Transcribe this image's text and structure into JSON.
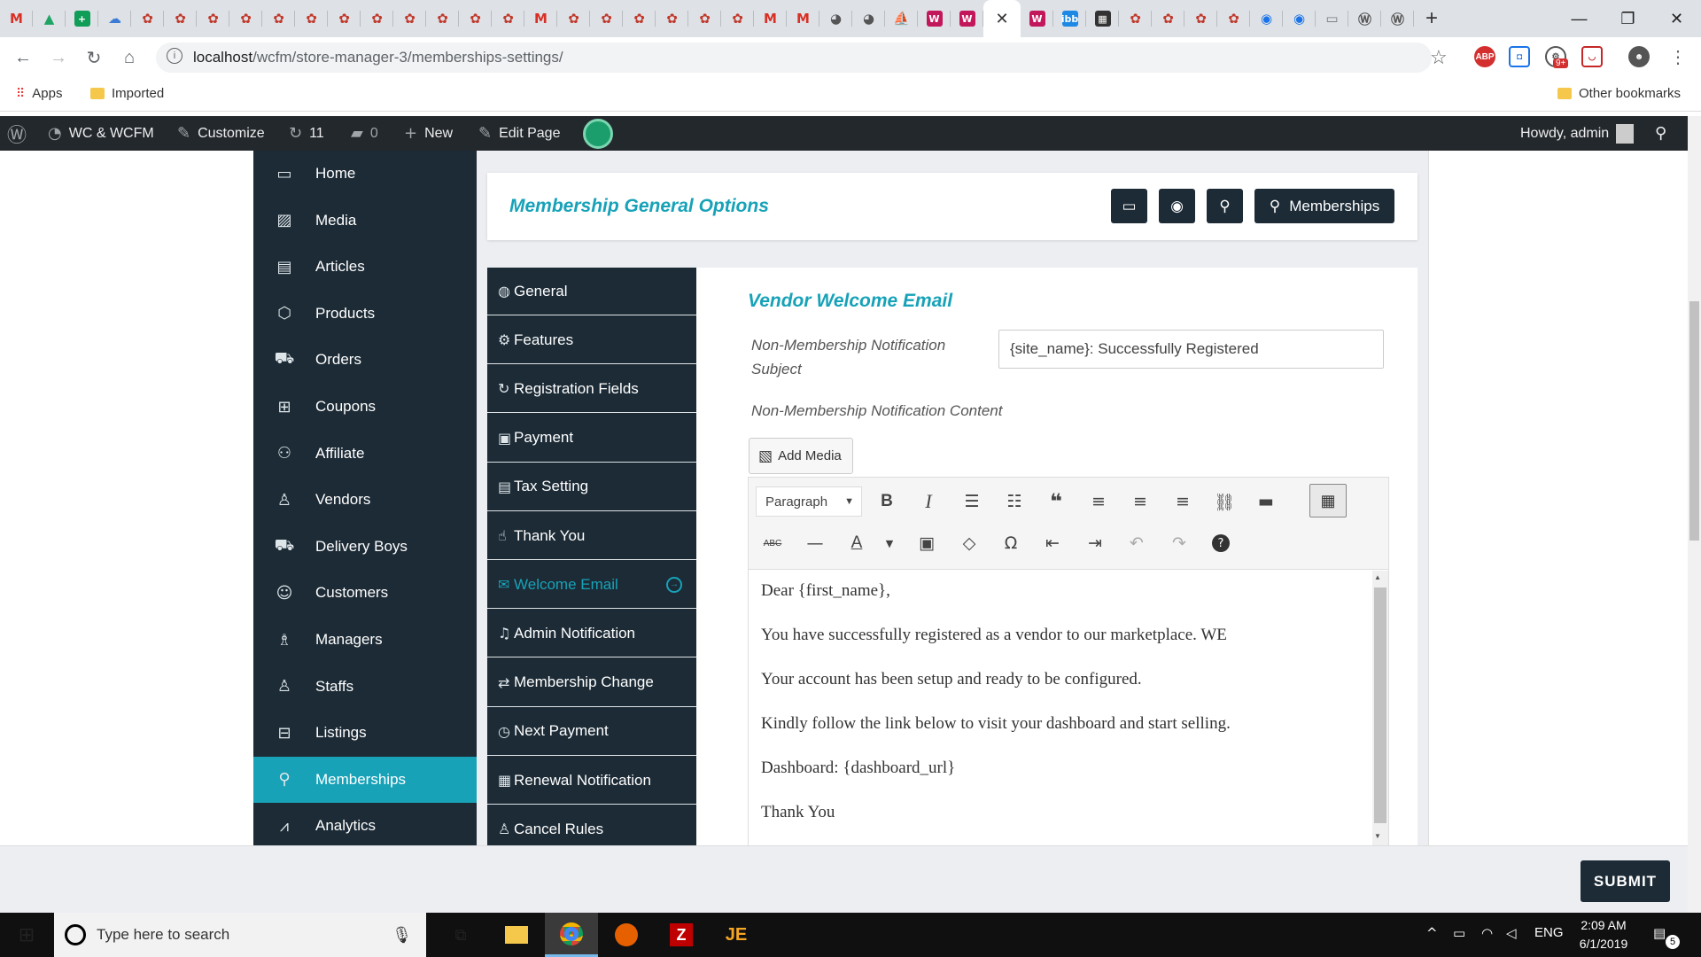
{
  "browser": {
    "tab_favicons": [
      {
        "icon": "gmail-icon",
        "glyph": "M",
        "color": "#d93025",
        "bg": "transparent"
      },
      {
        "icon": "google-drive-icon",
        "glyph": "▲",
        "color": "#1fa463",
        "bg": "transparent"
      },
      {
        "icon": "google-sheets-icon",
        "glyph": "+",
        "color": "#fff",
        "bg": "#0f9d58"
      },
      {
        "icon": "cloud-icon",
        "glyph": "☁",
        "color": "#3a7bd5",
        "bg": "transparent"
      },
      {
        "icon": "wcfm-icon",
        "glyph": "✿",
        "color": "#c0392b",
        "bg": "transparent"
      },
      {
        "icon": "wcfm-icon",
        "glyph": "✿",
        "color": "#c0392b",
        "bg": "transparent"
      },
      {
        "icon": "wcfm-icon",
        "glyph": "✿",
        "color": "#c0392b",
        "bg": "transparent"
      },
      {
        "icon": "wcfm-icon",
        "glyph": "✿",
        "color": "#c0392b",
        "bg": "transparent"
      },
      {
        "icon": "wcfm-icon",
        "glyph": "✿",
        "color": "#c0392b",
        "bg": "transparent"
      },
      {
        "icon": "wcfm-icon",
        "glyph": "✿",
        "color": "#c0392b",
        "bg": "transparent"
      },
      {
        "icon": "wcfm-icon",
        "glyph": "✿",
        "color": "#c0392b",
        "bg": "transparent"
      },
      {
        "icon": "wcfm-icon",
        "glyph": "✿",
        "color": "#c0392b",
        "bg": "transparent"
      },
      {
        "icon": "wcfm-icon",
        "glyph": "✿",
        "color": "#c0392b",
        "bg": "transparent"
      },
      {
        "icon": "wcfm-icon",
        "glyph": "✿",
        "color": "#c0392b",
        "bg": "transparent"
      },
      {
        "icon": "wcfm-icon",
        "glyph": "✿",
        "color": "#c0392b",
        "bg": "transparent"
      },
      {
        "icon": "wcfm-icon",
        "glyph": "✿",
        "color": "#c0392b",
        "bg": "transparent"
      },
      {
        "icon": "gmail-icon",
        "glyph": "M",
        "color": "#d93025",
        "bg": "transparent"
      },
      {
        "icon": "wcfm-icon",
        "glyph": "✿",
        "color": "#c0392b",
        "bg": "transparent"
      },
      {
        "icon": "wcfm-icon",
        "glyph": "✿",
        "color": "#c0392b",
        "bg": "transparent"
      },
      {
        "icon": "wcfm-icon",
        "glyph": "✿",
        "color": "#c0392b",
        "bg": "transparent"
      },
      {
        "icon": "wcfm-icon",
        "glyph": "✿",
        "color": "#c0392b",
        "bg": "transparent"
      },
      {
        "icon": "wcfm-icon",
        "glyph": "✿",
        "color": "#c0392b",
        "bg": "transparent"
      },
      {
        "icon": "wcfm-icon",
        "glyph": "✿",
        "color": "#c0392b",
        "bg": "transparent"
      },
      {
        "icon": "gmail-icon",
        "glyph": "M",
        "color": "#d93025",
        "bg": "transparent"
      },
      {
        "icon": "gmail-icon",
        "glyph": "M",
        "color": "#d93025",
        "bg": "transparent"
      },
      {
        "icon": "globe-icon",
        "glyph": "◕",
        "color": "#555",
        "bg": "transparent"
      },
      {
        "icon": "globe-icon",
        "glyph": "◕",
        "color": "#555",
        "bg": "transparent"
      },
      {
        "icon": "phpmyadmin-icon",
        "glyph": "⛵",
        "color": "#e67e22",
        "bg": "transparent"
      },
      {
        "icon": "woocommerce-icon",
        "glyph": "W",
        "color": "#fff",
        "bg": "#c2185b"
      },
      {
        "icon": "woocommerce-icon",
        "glyph": "W",
        "color": "#fff",
        "bg": "#c2185b"
      }
    ],
    "tab_favicons_right": [
      {
        "icon": "woocommerce-icon",
        "glyph": "W",
        "color": "#fff",
        "bg": "#c2185b"
      },
      {
        "icon": "imgbb-icon",
        "glyph": "ibb",
        "color": "#fff",
        "bg": "#1e88e5"
      },
      {
        "icon": "film-icon",
        "glyph": "▦",
        "color": "#fff",
        "bg": "#333"
      },
      {
        "icon": "wcfm-icon",
        "glyph": "✿",
        "color": "#c0392b",
        "bg": "transparent"
      },
      {
        "icon": "wcfm-icon",
        "glyph": "✿",
        "color": "#c0392b",
        "bg": "transparent"
      },
      {
        "icon": "wcfm-icon",
        "glyph": "✿",
        "color": "#c0392b",
        "bg": "transparent"
      },
      {
        "icon": "wcfm-icon",
        "glyph": "✿",
        "color": "#c0392b",
        "bg": "transparent"
      },
      {
        "icon": "browser-icon",
        "glyph": "◉",
        "color": "#1a73e8",
        "bg": "transparent"
      },
      {
        "icon": "browser-icon",
        "glyph": "◉",
        "color": "#1a73e8",
        "bg": "transparent"
      },
      {
        "icon": "monitor-icon",
        "glyph": "▭",
        "color": "#777",
        "bg": "transparent"
      },
      {
        "icon": "wordpress-icon",
        "glyph": "Ⓦ",
        "color": "#555",
        "bg": "transparent"
      },
      {
        "icon": "wordpress-icon",
        "glyph": "Ⓦ",
        "color": "#555",
        "bg": "transparent"
      }
    ],
    "url_prefix": "localhost",
    "url_path": "/wcfm/store-manager-3/memberships-settings/",
    "bookmarks": {
      "apps": "Apps",
      "imported": "Imported",
      "other": "Other bookmarks"
    },
    "extension_badge": "9+"
  },
  "adminbar": {
    "site_name": "WC & WCFM",
    "customize": "Customize",
    "updates_count": "11",
    "comments_count": "0",
    "new": "New",
    "edit_page": "Edit Page",
    "howdy": "Howdy, admin"
  },
  "main_nav": {
    "items": [
      {
        "label": "Home",
        "icon": "home-icon",
        "glyph": "▭"
      },
      {
        "label": "Media",
        "icon": "media-icon",
        "glyph": "▨"
      },
      {
        "label": "Articles",
        "icon": "articles-icon",
        "glyph": "▤"
      },
      {
        "label": "Products",
        "icon": "products-icon",
        "glyph": "⬡"
      },
      {
        "label": "Orders",
        "icon": "cart-icon",
        "glyph": "⛟"
      },
      {
        "label": "Coupons",
        "icon": "gift-icon",
        "glyph": "⊞"
      },
      {
        "label": "Affiliate",
        "icon": "users-icon",
        "glyph": "⚇"
      },
      {
        "label": "Vendors",
        "icon": "user-icon",
        "glyph": "♙"
      },
      {
        "label": "Delivery Boys",
        "icon": "truck-icon",
        "glyph": "⛟"
      },
      {
        "label": "Customers",
        "icon": "user-circle-icon",
        "glyph": "☺"
      },
      {
        "label": "Managers",
        "icon": "user-tie-icon",
        "glyph": "♗"
      },
      {
        "label": "Staffs",
        "icon": "user-icon",
        "glyph": "♙"
      },
      {
        "label": "Listings",
        "icon": "briefcase-icon",
        "glyph": "⊟"
      },
      {
        "label": "Memberships",
        "icon": "user-plus-icon",
        "glyph": "⚲"
      },
      {
        "label": "Analytics",
        "icon": "chart-icon",
        "glyph": "⩘"
      }
    ],
    "active_index": 13
  },
  "header": {
    "title": "Membership General Options",
    "memberships_button": "Memberships"
  },
  "settings_nav": {
    "items": [
      {
        "label": "General",
        "icon": "globe-icon",
        "glyph": "◍"
      },
      {
        "label": "Features",
        "icon": "gear-icon",
        "glyph": "⚙"
      },
      {
        "label": "Registration Fields",
        "icon": "refresh-icon",
        "glyph": "↻"
      },
      {
        "label": "Payment",
        "icon": "money-icon",
        "glyph": "▣"
      },
      {
        "label": "Tax Setting",
        "icon": "id-card-icon",
        "glyph": "▤"
      },
      {
        "label": "Thank You",
        "icon": "thumbs-up-icon",
        "glyph": "☝"
      },
      {
        "label": "Welcome Email",
        "icon": "envelope-icon",
        "glyph": "✉"
      },
      {
        "label": "Admin Notification",
        "icon": "bell-icon",
        "glyph": "♫"
      },
      {
        "label": "Membership Change",
        "icon": "exchange-icon",
        "glyph": "⇄"
      },
      {
        "label": "Next Payment",
        "icon": "clock-icon",
        "glyph": "◷"
      },
      {
        "label": "Renewal Notification",
        "icon": "calendar-icon",
        "glyph": "▦"
      },
      {
        "label": "Cancel Rules",
        "icon": "user-times-icon",
        "glyph": "♙"
      }
    ],
    "active_index": 6
  },
  "form": {
    "section_title": "Vendor Welcome Email",
    "subject_label": "Non-Membership Notification Subject",
    "subject_value": "{site_name}: Successfully Registered",
    "content_label": "Non-Membership Notification Content",
    "add_media": "Add Media",
    "format_select": "Paragraph"
  },
  "editor": {
    "paragraphs": [
      "Dear {first_name},",
      "You have successfully registered as a vendor to our marketplace.  WE",
      "Your account has been setup and ready to be configured.",
      "Kindly follow the link below to visit your dashboard and start selling.",
      "Dashboard: {dashboard_url}",
      "Thank You"
    ],
    "strikethrough_label": "ABC"
  },
  "footer": {
    "submit": "SUBMIT"
  },
  "taskbar": {
    "search_placeholder": "Type here to search",
    "language": "ENG",
    "time": "2:09 AM",
    "date": "6/1/2019",
    "notifications": "5"
  },
  "colors": {
    "accent": "#17a2b8",
    "nav_bg": "#1c2b36",
    "admin_bar": "#23282d"
  }
}
